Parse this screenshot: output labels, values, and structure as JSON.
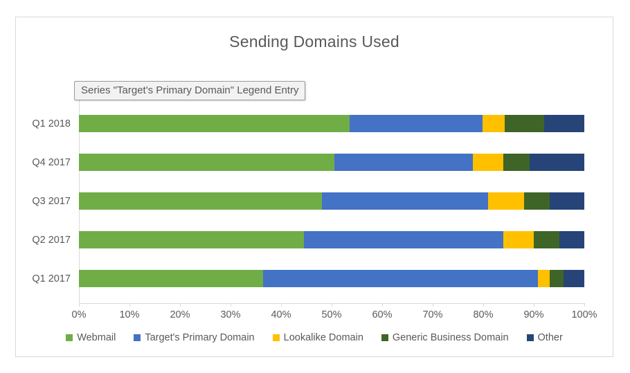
{
  "tooltip": {
    "text": "Series \"Target's Primary Domain\" Legend Entry"
  },
  "chart_data": {
    "type": "bar",
    "orientation": "horizontal",
    "stacked": "100%",
    "title": "Sending Domains Used",
    "xlabel": "",
    "ylabel": "",
    "xlim": [
      0,
      100
    ],
    "xticks": [
      "0%",
      "10%",
      "20%",
      "30%",
      "40%",
      "50%",
      "60%",
      "70%",
      "80%",
      "90%",
      "100%"
    ],
    "xtick_values": [
      0,
      10,
      20,
      30,
      40,
      50,
      60,
      70,
      80,
      90,
      100
    ],
    "grid": false,
    "legend_position": "bottom",
    "categories": [
      "Q1 2018",
      "Q4 2017",
      "Q3 2017",
      "Q2 2017",
      "Q1 2017"
    ],
    "series": [
      {
        "name": "Webmail",
        "color": "#70AD47",
        "values": [
          53.6,
          50.5,
          48.1,
          44.5,
          36.4
        ]
      },
      {
        "name": "Target's Primary Domain",
        "color": "#4472C4",
        "values": [
          26.2,
          27.4,
          32.9,
          39.5,
          54.4
        ]
      },
      {
        "name": "Lookalike Domain",
        "color": "#FFC000",
        "values": [
          4.4,
          6.1,
          7.1,
          6.0,
          2.4
        ]
      },
      {
        "name": "Generic Business Domain",
        "color": "#3F6427",
        "values": [
          7.9,
          5.2,
          5.1,
          5.1,
          2.7
        ]
      },
      {
        "name": "Other",
        "color": "#264478",
        "values": [
          7.9,
          10.8,
          6.8,
          4.9,
          4.1
        ]
      }
    ]
  }
}
